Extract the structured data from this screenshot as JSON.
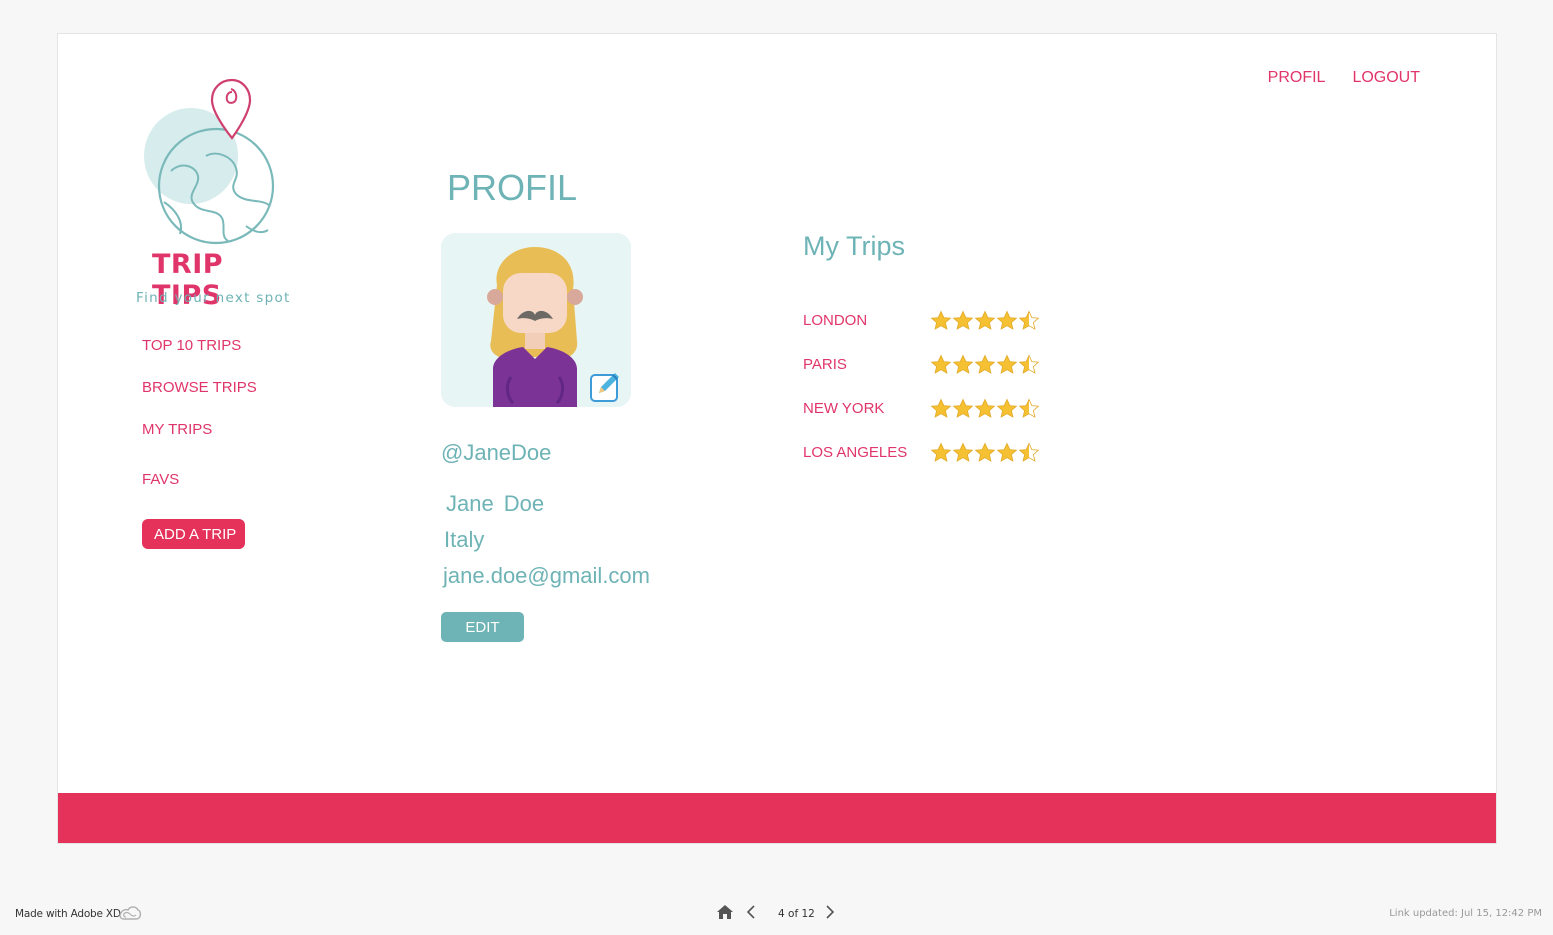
{
  "brand": {
    "name": "TRIP TIPS",
    "tagline": "Find your next spot"
  },
  "topnav": {
    "profil": "PROFIL",
    "logout": "LOGOUT"
  },
  "sidebar": {
    "items": [
      {
        "label": "TOP 10 TRIPS"
      },
      {
        "label": "BROWSE TRIPS"
      },
      {
        "label": "MY TRIPS"
      },
      {
        "label": "FAVS"
      }
    ],
    "add_trip": "ADD A TRIP"
  },
  "profile": {
    "title": "PROFIL",
    "username": "@JaneDoe",
    "first_name": "Jane",
    "last_name": "Doe",
    "country": "Italy",
    "email": "jane.doe@gmail.com",
    "edit_label": "EDIT"
  },
  "my_trips": {
    "title": "My Trips",
    "trips": [
      {
        "name": "LONDON",
        "rating": 4.5
      },
      {
        "name": "PARIS",
        "rating": 4.5
      },
      {
        "name": "NEW YORK",
        "rating": 4.5
      },
      {
        "name": "LOS ANGELES",
        "rating": 4.5
      }
    ]
  },
  "viewer": {
    "made_with": "Made with Adobe XD",
    "page_count": "4 of 12",
    "link_updated": "Link updated: Jul 15, 12:42 PM"
  },
  "colors": {
    "accent": "#e0356a",
    "band": "#e5325a",
    "teal": "#6eb3b5",
    "star": "#f5c031"
  },
  "icons": [
    "location-pin-icon",
    "globe-icon",
    "pencil-edit-icon",
    "star-icon",
    "home-icon",
    "chevron-left-icon",
    "chevron-right-icon",
    "creative-cloud-icon"
  ]
}
